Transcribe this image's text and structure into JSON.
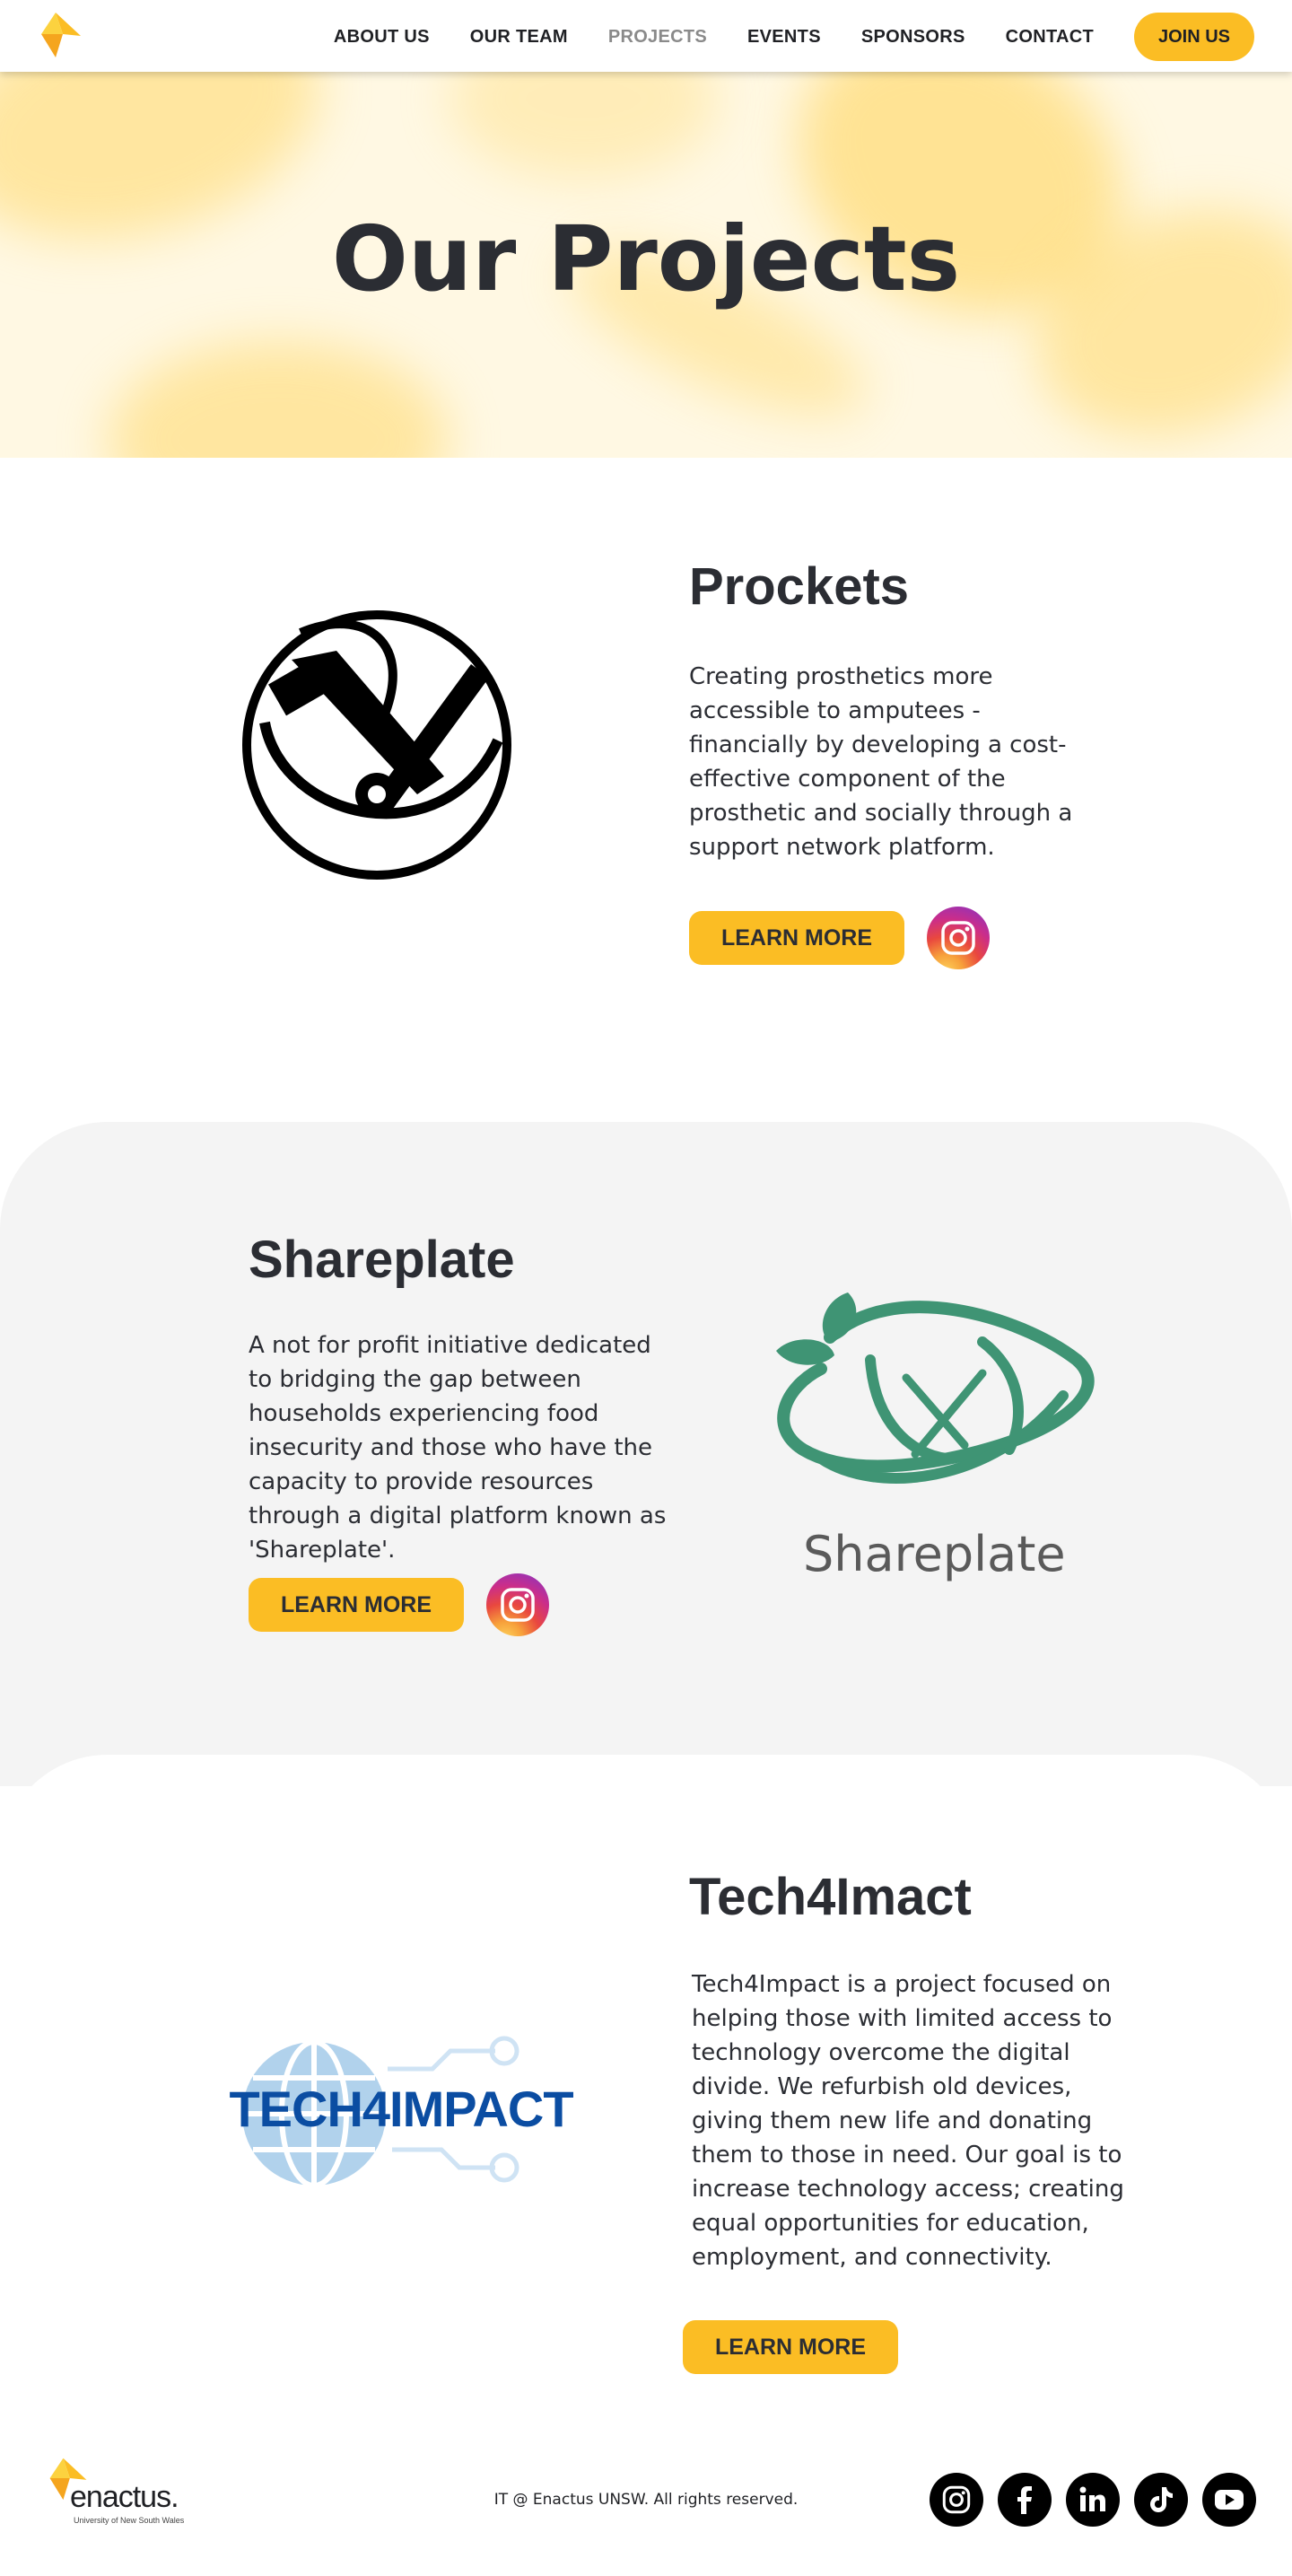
{
  "nav": {
    "logo_icon": "enactus-mark-icon",
    "links": [
      {
        "label": "ABOUT US"
      },
      {
        "label": "OUR TEAM"
      },
      {
        "label": "PROJECTS",
        "active": true
      },
      {
        "label": "EVENTS"
      },
      {
        "label": "SPONSORS"
      },
      {
        "label": "CONTACT"
      }
    ],
    "join_label": "JOIN US"
  },
  "hero": {
    "title": "Our Projects"
  },
  "projects": [
    {
      "title": "Prockets",
      "description": "Creating prosthetics more accessible to amputees - financially by developing a cost-effective component of the prosthetic and socially through a support network platform.",
      "button_label": "LEARN MORE",
      "has_instagram": true,
      "logo_icon": "prockets-logo-icon"
    },
    {
      "title": "Shareplate",
      "description": "A not for profit initiative dedicated to bridging the gap between households experiencing food insecurity and those who have the capacity to provide resources through a digital platform known as 'Shareplate'.",
      "button_label": "LEARN MORE",
      "has_instagram": true,
      "logo_text": "Shareplate",
      "logo_icon": "shareplate-logo-icon"
    },
    {
      "title": "Tech4Imact",
      "description": "Tech4Impact is a project focused on helping those with limited access to technology overcome the digital divide. We refurbish old devices, giving them new life and donating them to those in need. Our goal is to increase technology access; creating equal opportunities for education, employment, and connectivity.",
      "button_label": "LEARN MORE",
      "has_instagram": false,
      "logo_text": "TECH4IMPACT",
      "logo_icon": "tech4impact-globe-icon"
    }
  ],
  "footer": {
    "logo_text": "enactus.",
    "logo_subtext": "University of New South Wales",
    "copyright": "IT @ Enactus UNSW. All rights reserved.",
    "socials": [
      "instagram-icon",
      "facebook-icon",
      "linkedin-icon",
      "tiktok-icon",
      "youtube-icon"
    ]
  },
  "colors": {
    "accent": "#fbbd24",
    "text": "#2b2d33",
    "section_alt_bg": "#f4f4f4",
    "shareplate_green": "#3f9474",
    "tech4impact_blue": "#0b4da2"
  }
}
